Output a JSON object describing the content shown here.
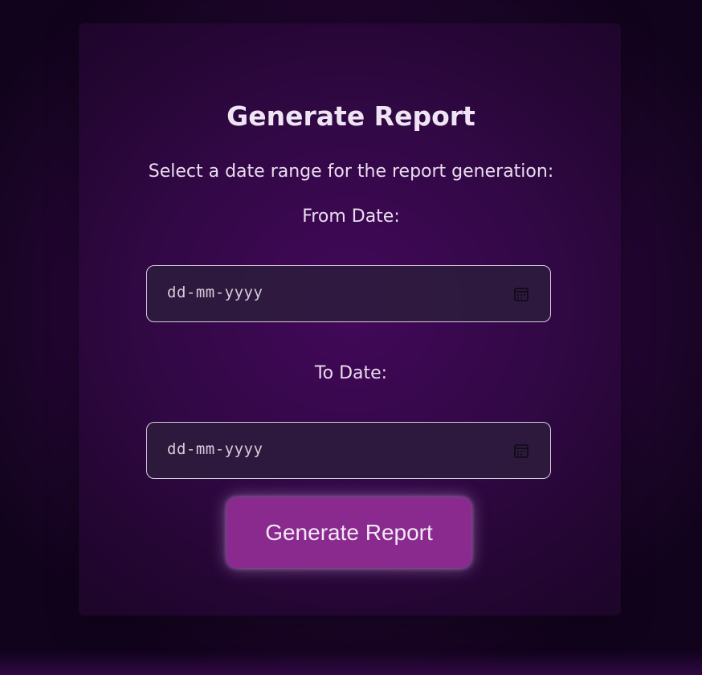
{
  "form": {
    "title": "Generate Report",
    "subtitle": "Select a date range for the report generation:",
    "from_label": "From Date:",
    "from_placeholder": "dd-mm-yyyy",
    "to_label": "To Date:",
    "to_placeholder": "dd-mm-yyyy",
    "submit_label": "Generate Report",
    "calendar_icon": "calendar-icon"
  },
  "colors": {
    "background": "#2f0744",
    "button": "#8a2a8f",
    "text": "#efe4f3"
  }
}
